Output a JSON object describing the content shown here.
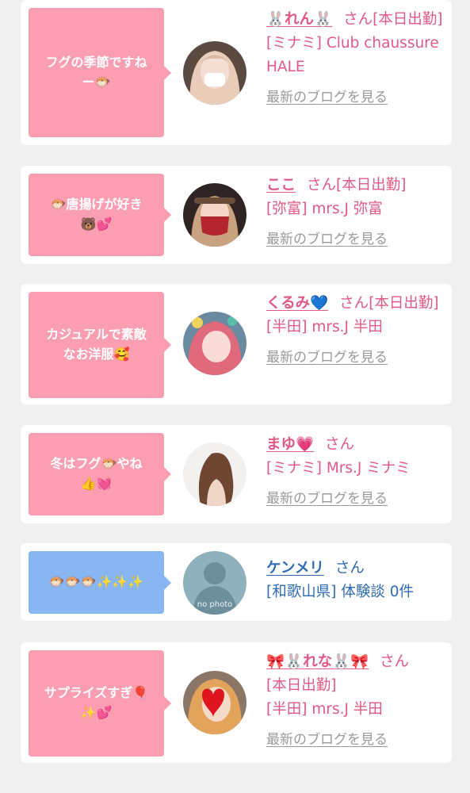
{
  "colors": {
    "pink_bubble": "#fb9eb2",
    "blue_bubble": "#88b6f2",
    "pink_text": "#e05a83",
    "blue_text": "#2f6cb3",
    "link_gray": "#9a9a9a",
    "background": "#f0f0f0"
  },
  "cards": [
    {
      "bubble_lines": [
        "フグの季節ですね",
        "ー🐡"
      ],
      "bubble_color": "pink",
      "avatar": "avatar-masked-girl",
      "name": "🐰れん🐰",
      "san": "さん",
      "status": "[本日出勤]",
      "shop": "[ミナミ] Club chaussure HALE",
      "blog_link": "最新のブログを見る"
    },
    {
      "bubble_lines": [
        "🐡唐揚げが好き",
        "🐻💕"
      ],
      "bubble_color": "pink",
      "avatar": "avatar-red-mask-girl",
      "name": "ここ",
      "san": "さん",
      "status": "[本日出勤]",
      "shop": "[弥富] mrs.J 弥富",
      "blog_link": "最新のブログを見る"
    },
    {
      "bubble_lines": [
        "カジュアルで素敵",
        "なお洋服🥰"
      ],
      "bubble_color": "pink",
      "avatar": "avatar-pink-hair-girl",
      "name": "くるみ💙",
      "san": "さん",
      "status": "[本日出勤]",
      "shop": "[半田] mrs.J 半田",
      "blog_link": "最新のブログを見る"
    },
    {
      "bubble_lines": [
        "冬はフグ🐡やね",
        "👍💓"
      ],
      "bubble_color": "pink",
      "avatar": "avatar-long-hair-woman",
      "name": "まゆ💗",
      "san": "さん",
      "status": "",
      "shop": "[ミナミ] Mrs.J ミナミ",
      "blog_link": "最新のブログを見る"
    },
    {
      "bubble_lines": [
        "🐡🐡🐡✨✨✨"
      ],
      "bubble_color": "blue",
      "avatar": "avatar-no-photo",
      "avatar_text": "no photo",
      "name": "ケンメリ",
      "san": "さん",
      "status": "",
      "shop": "[和歌山県] 体験談 0件",
      "blog_link": ""
    },
    {
      "bubble_lines": [
        "サプライズすぎ🎈",
        "✨💕"
      ],
      "bubble_color": "pink",
      "avatar": "avatar-heart-face-girl",
      "name": "🎀🐰れな🐰🎀",
      "san": "さん",
      "status": "[本日出勤]",
      "shop": "[半田] mrs.J 半田",
      "blog_link": "最新のブログを見る"
    }
  ]
}
